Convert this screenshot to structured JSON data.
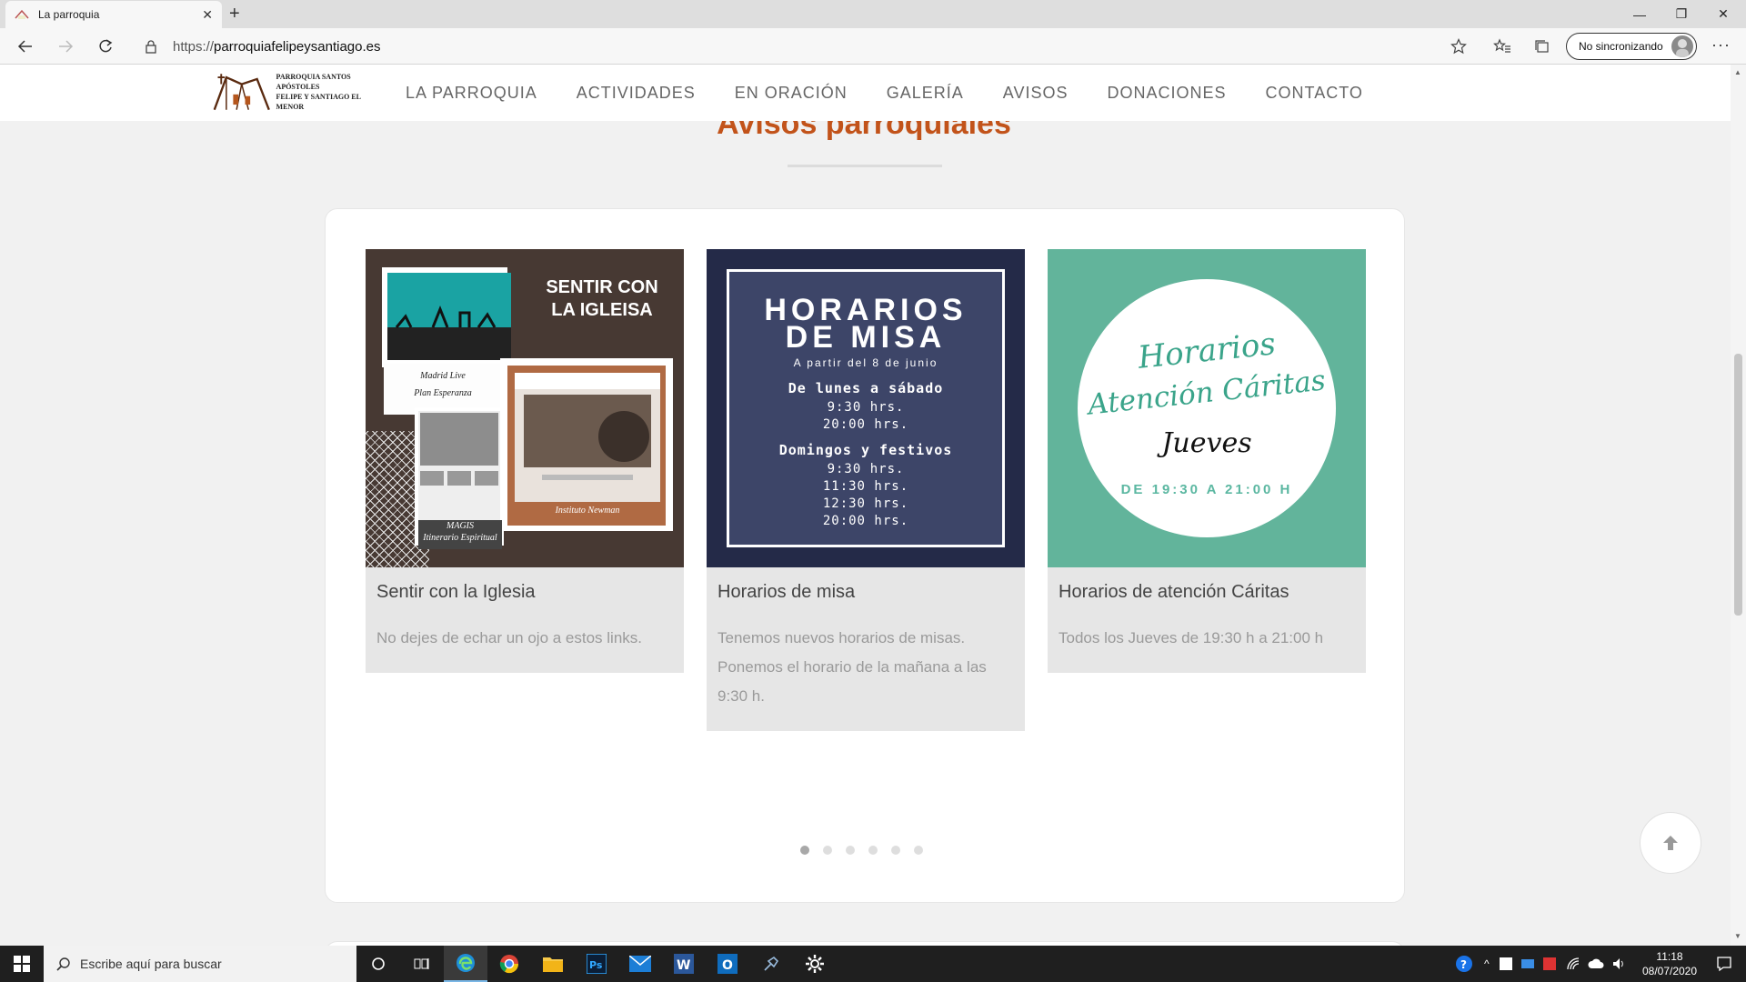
{
  "browser": {
    "tab_title": "La parroquia",
    "url_protocol": "https://",
    "url_host": "parroquiafelipeysantiago.es",
    "sync_label": "No sincronizando"
  },
  "site": {
    "logo_line1": "PARROQUIA SANTOS APÓSTOLES",
    "logo_line2": "FELIPE Y SANTIAGO EL MENOR",
    "nav": [
      "LA PARROQUIA",
      "ACTIVIDADES",
      "EN ORACIÓN",
      "GALERÍA",
      "AVISOS",
      "DONACIONES",
      "CONTACTO"
    ],
    "section_title": "Avisos parroquiales"
  },
  "cards": [
    {
      "title": "Sentir con la Iglesia",
      "text": "No dejes de echar un ojo a estos links.",
      "art": {
        "heading_1": "SENTIR CON",
        "heading_2": "LA IGLEISA",
        "caption_1a": "Madrid Live",
        "caption_1b": "Plan Esperanza",
        "caption_2": "Instituto Newman",
        "caption_3a": "MAGIS",
        "caption_3b": "Itinerario Espiritual"
      }
    },
    {
      "title": "Horarios de misa",
      "text": "Tenemos nuevos horarios de misas. Ponemos el horario de la mañana a las 9:30 h.",
      "art": {
        "line1": "HORARIOS",
        "line2": "DE MISA",
        "since": "A partir del 8 de junio",
        "weekdays": "De lunes a sábado",
        "wd_times": [
          "9:30 hrs.",
          "20:00 hrs."
        ],
        "sundays": "Domingos y festivos",
        "sun_times": [
          "9:30 hrs.",
          "11:30 hrs.",
          "12:30 hrs.",
          "20:00 hrs."
        ]
      }
    },
    {
      "title": "Horarios de atención Cáritas",
      "text": "Todos los Jueves de 19:30 h a 21:00 h",
      "art": {
        "line1": "Horarios",
        "line2": "Atención Cáritas",
        "line3": "Jueves",
        "line4": "DE 19:30 A 21:00 H"
      }
    }
  ],
  "carousel": {
    "dot_count": 6,
    "active_dot": 0
  },
  "taskbar": {
    "search_placeholder": "Escribe aquí para buscar",
    "time": "11:18",
    "date": "08/07/2020"
  },
  "colors": {
    "accent": "#c2531a",
    "teal": "#62b49b",
    "navy": "#242a48"
  }
}
